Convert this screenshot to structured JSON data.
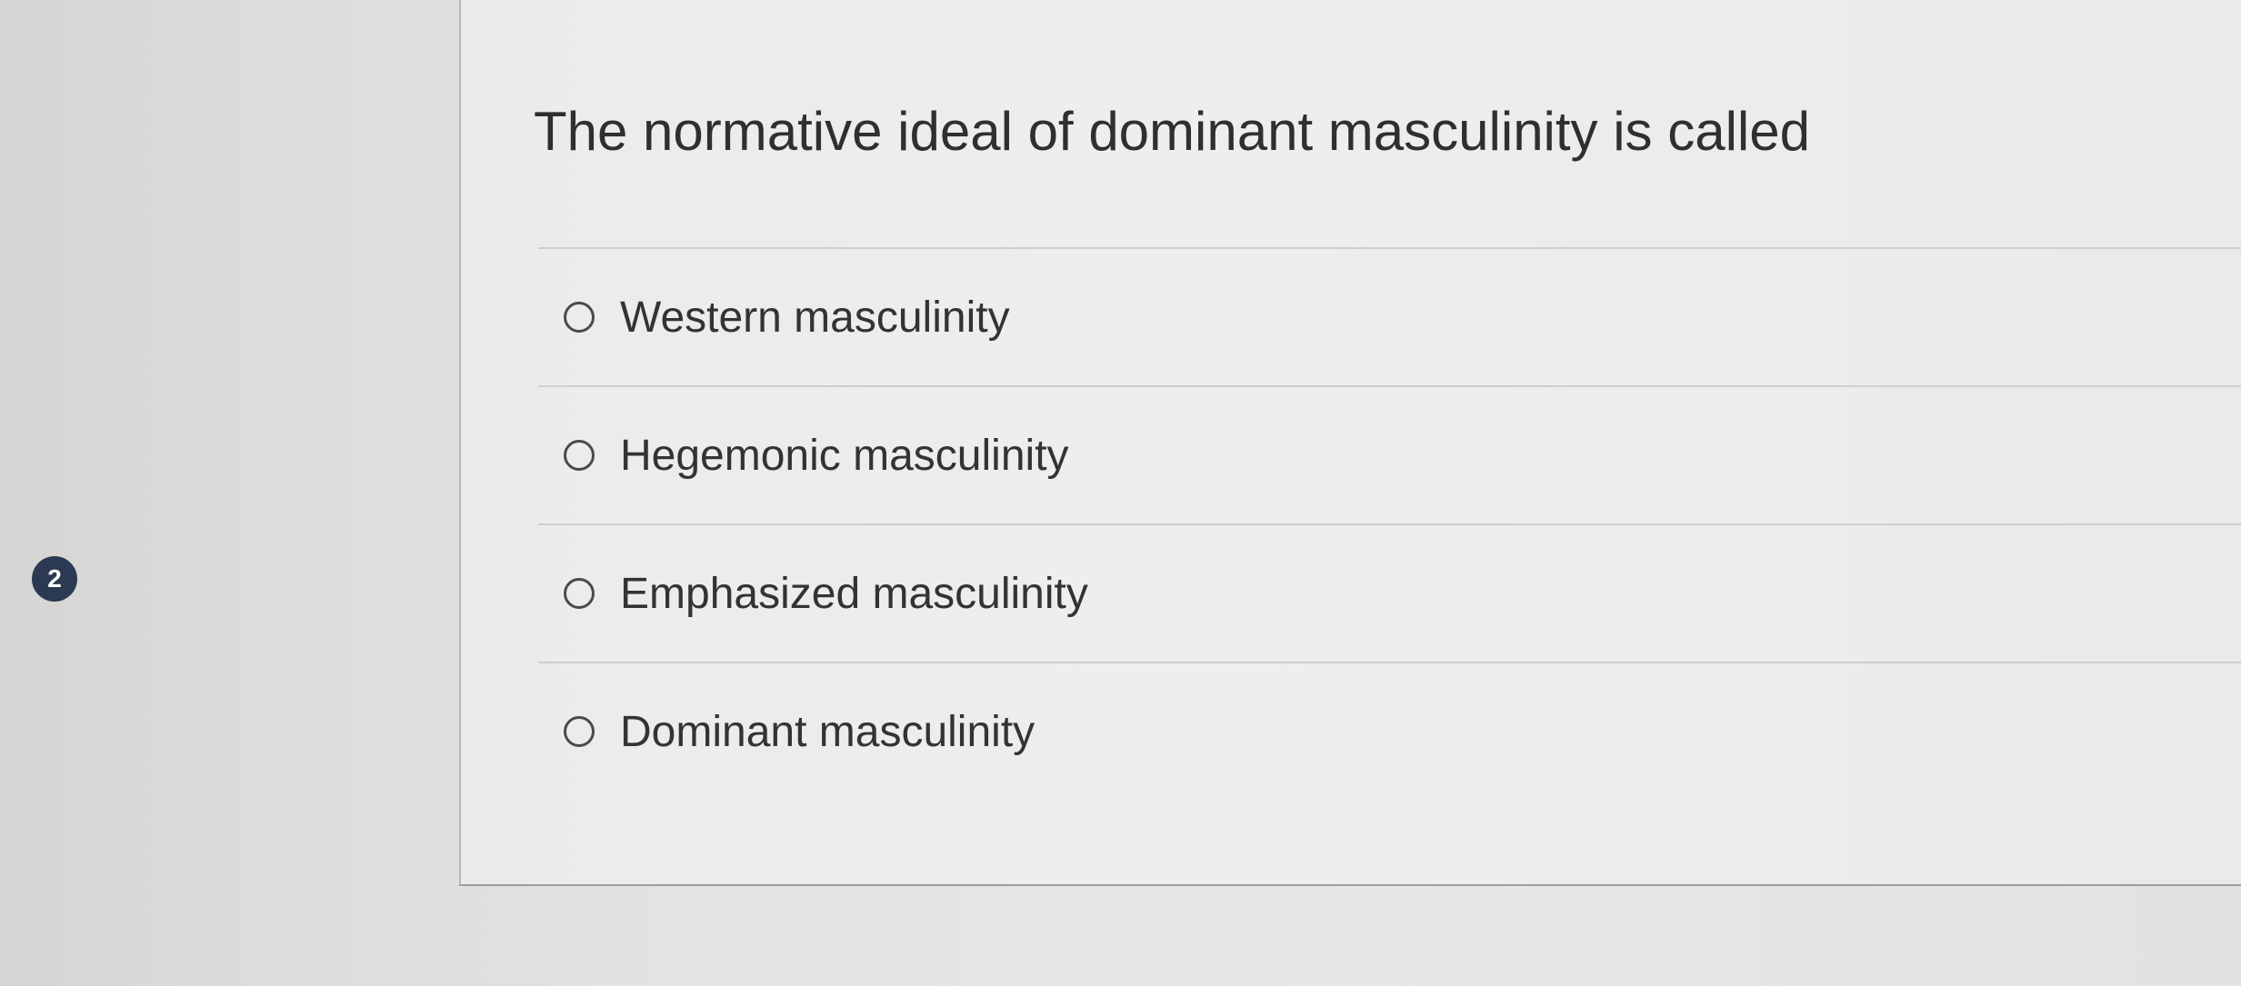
{
  "question": {
    "number": "2",
    "text": "The normative ideal of dominant masculinity is called",
    "options": [
      {
        "label": "Western masculinity",
        "selected": false
      },
      {
        "label": "Hegemonic masculinity",
        "selected": false
      },
      {
        "label": "Emphasized masculinity",
        "selected": false
      },
      {
        "label": "Dominant masculinity",
        "selected": false
      }
    ]
  },
  "colors": {
    "badge_background": "#2b3a52",
    "badge_text": "#ffffff",
    "text": "#2f2f2f",
    "divider": "#cfcecc"
  }
}
